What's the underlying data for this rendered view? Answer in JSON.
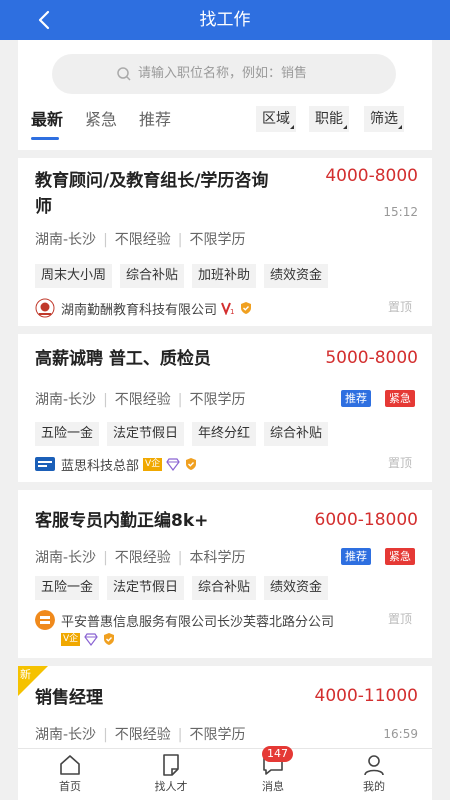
{
  "header": {
    "title": "找工作"
  },
  "search": {
    "placeholder": "请输入职位名称，例如：销售"
  },
  "tabs": [
    {
      "label": "最新"
    },
    {
      "label": "紧急"
    },
    {
      "label": "推荐"
    }
  ],
  "filters": [
    {
      "label": "区域"
    },
    {
      "label": "职能"
    },
    {
      "label": "筛选"
    }
  ],
  "jobs": [
    {
      "title_line1": "教育顾问/及教育组长/学历咨询",
      "title_line2": "师",
      "salary": "4000-8000",
      "time": "15:12",
      "location": "湖南-长沙",
      "experience": "不限经验",
      "education": "不限学历",
      "tags": [
        "周末大小周",
        "综合补贴",
        "加班补助",
        "绩效资金"
      ],
      "company": "湖南勤酬教育科技有限公司",
      "pin": "置顶"
    },
    {
      "title": "高薪诚聘 普工、质检员",
      "salary": "5000-8000",
      "badges": [
        "推荐",
        "紧急"
      ],
      "location": "湖南-长沙",
      "experience": "不限经验",
      "education": "不限学历",
      "tags": [
        "五险一金",
        "法定节假日",
        "年终分红",
        "综合补贴"
      ],
      "company": "蓝思科技总部",
      "pin": "置顶"
    },
    {
      "title": "客服专员内勤正编8k+",
      "salary": "6000-18000",
      "badges": [
        "推荐",
        "紧急"
      ],
      "location": "湖南-长沙",
      "experience": "不限经验",
      "education": "本科学历",
      "tags": [
        "五险一金",
        "法定节假日",
        "综合补贴",
        "绩效资金"
      ],
      "company": "平安普惠信息服务有限公司长沙芙蓉北路分公司",
      "pin": "置顶"
    },
    {
      "new_label": "新",
      "title": "销售经理",
      "salary": "4000-11000",
      "time": "16:59",
      "location": "湖南-长沙",
      "experience": "不限经验",
      "education": "不限学历"
    }
  ],
  "vip_label": "V企",
  "nav": [
    {
      "label": "首页",
      "icon": "home-icon"
    },
    {
      "label": "找人才",
      "icon": "document-icon"
    },
    {
      "label": "消息",
      "icon": "message-icon",
      "badge": "147"
    },
    {
      "label": "我的",
      "icon": "user-icon"
    }
  ],
  "colors": {
    "primary": "#2e6fe0",
    "salary": "#d32f2f",
    "urgent": "#e53935"
  }
}
